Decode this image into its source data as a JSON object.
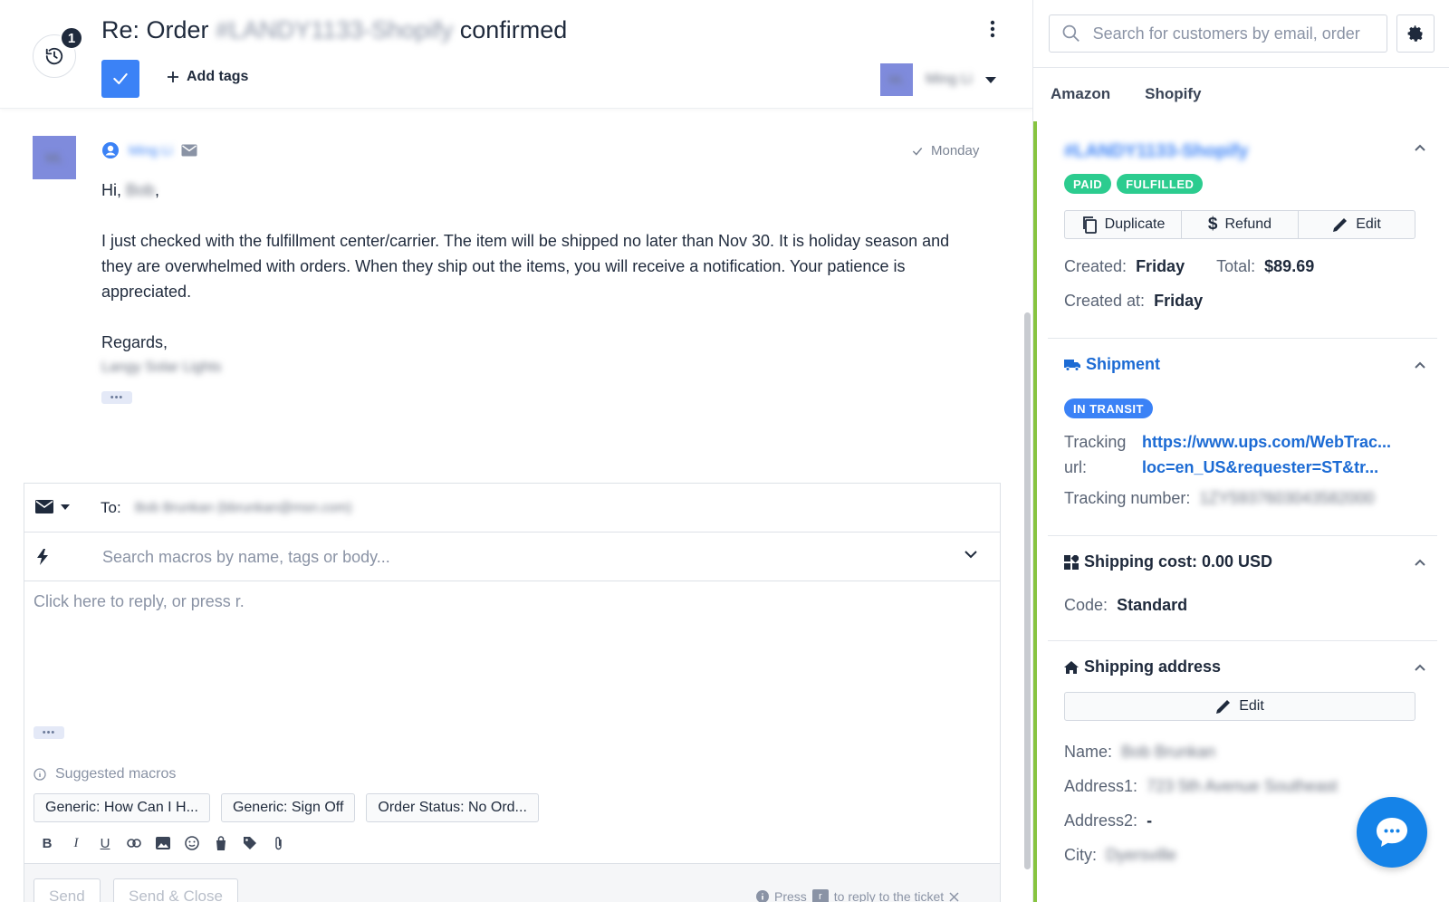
{
  "ticket": {
    "title_prefix": "Re: Order",
    "title_order_redacted": "#LANDY1133-Shopify",
    "title_suffix": "confirmed",
    "history_count": "1",
    "add_tags_label": "Add tags",
    "assignee_initials": "ML",
    "assignee_name_redacted": "Ming Li"
  },
  "message": {
    "avatar_initials": "ML",
    "sender_name_redacted": "Ming Li",
    "date": "Monday",
    "greeting_prefix": "Hi,",
    "greeting_name_redacted": "Bob",
    "greeting_suffix": ",",
    "body": "I just checked with the fulfillment center/carrier. The item will be shipped no later than Nov 30. It is holiday season and they are overwhelmed with orders. When they ship out the items, you will receive a notification. Your patience is appreciated.",
    "signoff": "Regards,",
    "signature_redacted": "Langy Solar Lights",
    "ellipsis": "•••"
  },
  "composer": {
    "to_label": "To:",
    "to_value_redacted": "Bob Brunkan (bbrunkan@msn.com)",
    "macro_placeholder": "Search macros by name, tags or body...",
    "reply_placeholder": "Click here to reply, or press r.",
    "ellipsis": "•••",
    "suggested_label": "Suggested macros",
    "macros": [
      "Generic: How Can I H...",
      "Generic: Sign Off",
      "Order Status: No Ord..."
    ],
    "format_tools": [
      "B",
      "I",
      "U"
    ],
    "send_label": "Send",
    "send_close_label": "Send & Close",
    "hint_prefix": "Press",
    "hint_key": "r",
    "hint_suffix": "to reply to the ticket"
  },
  "sidebar": {
    "search_placeholder": "Search for customers by email, order",
    "tabs": [
      "Amazon",
      "Shopify"
    ],
    "order": {
      "number_redacted": "#LANDY1133-Shopify",
      "badges": [
        "PAID",
        "FULFILLED"
      ],
      "actions": {
        "duplicate": "Duplicate",
        "refund": "Refund",
        "edit": "Edit"
      },
      "created_label": "Created:",
      "created_value": "Friday",
      "total_label": "Total:",
      "total_value": "$89.69",
      "created_at_label": "Created at:",
      "created_at_value": "Friday"
    },
    "shipment": {
      "title": "Shipment",
      "status": "IN TRANSIT",
      "tracking_label_1": "Tracking",
      "tracking_label_2": "url:",
      "tracking_url_1": "https://www.ups.com/WebTrac...",
      "tracking_url_2": "loc=en_US&requester=ST&tr...",
      "tracking_number_label": "Tracking number:",
      "tracking_number_redacted": "1ZY5937603043582000"
    },
    "shipping_cost": {
      "title": "Shipping cost: 0.00 USD",
      "code_label": "Code:",
      "code_value": "Standard"
    },
    "shipping_address": {
      "title": "Shipping address",
      "edit_label": "Edit",
      "name_label": "Name:",
      "name_redacted": "Bob Brunkan",
      "address1_label": "Address1:",
      "address1_redacted": "723 5th Avenue Southeast",
      "address2_label": "Address2:",
      "address2_value": "-",
      "city_label": "City:",
      "city_redacted": "Dyersville"
    }
  },
  "colors": {
    "primary": "#3b82f6",
    "link": "#1c6bd4",
    "badge_green": "#2ccc8f",
    "rail_green": "#87c440",
    "chat_fab": "#1583e8"
  }
}
